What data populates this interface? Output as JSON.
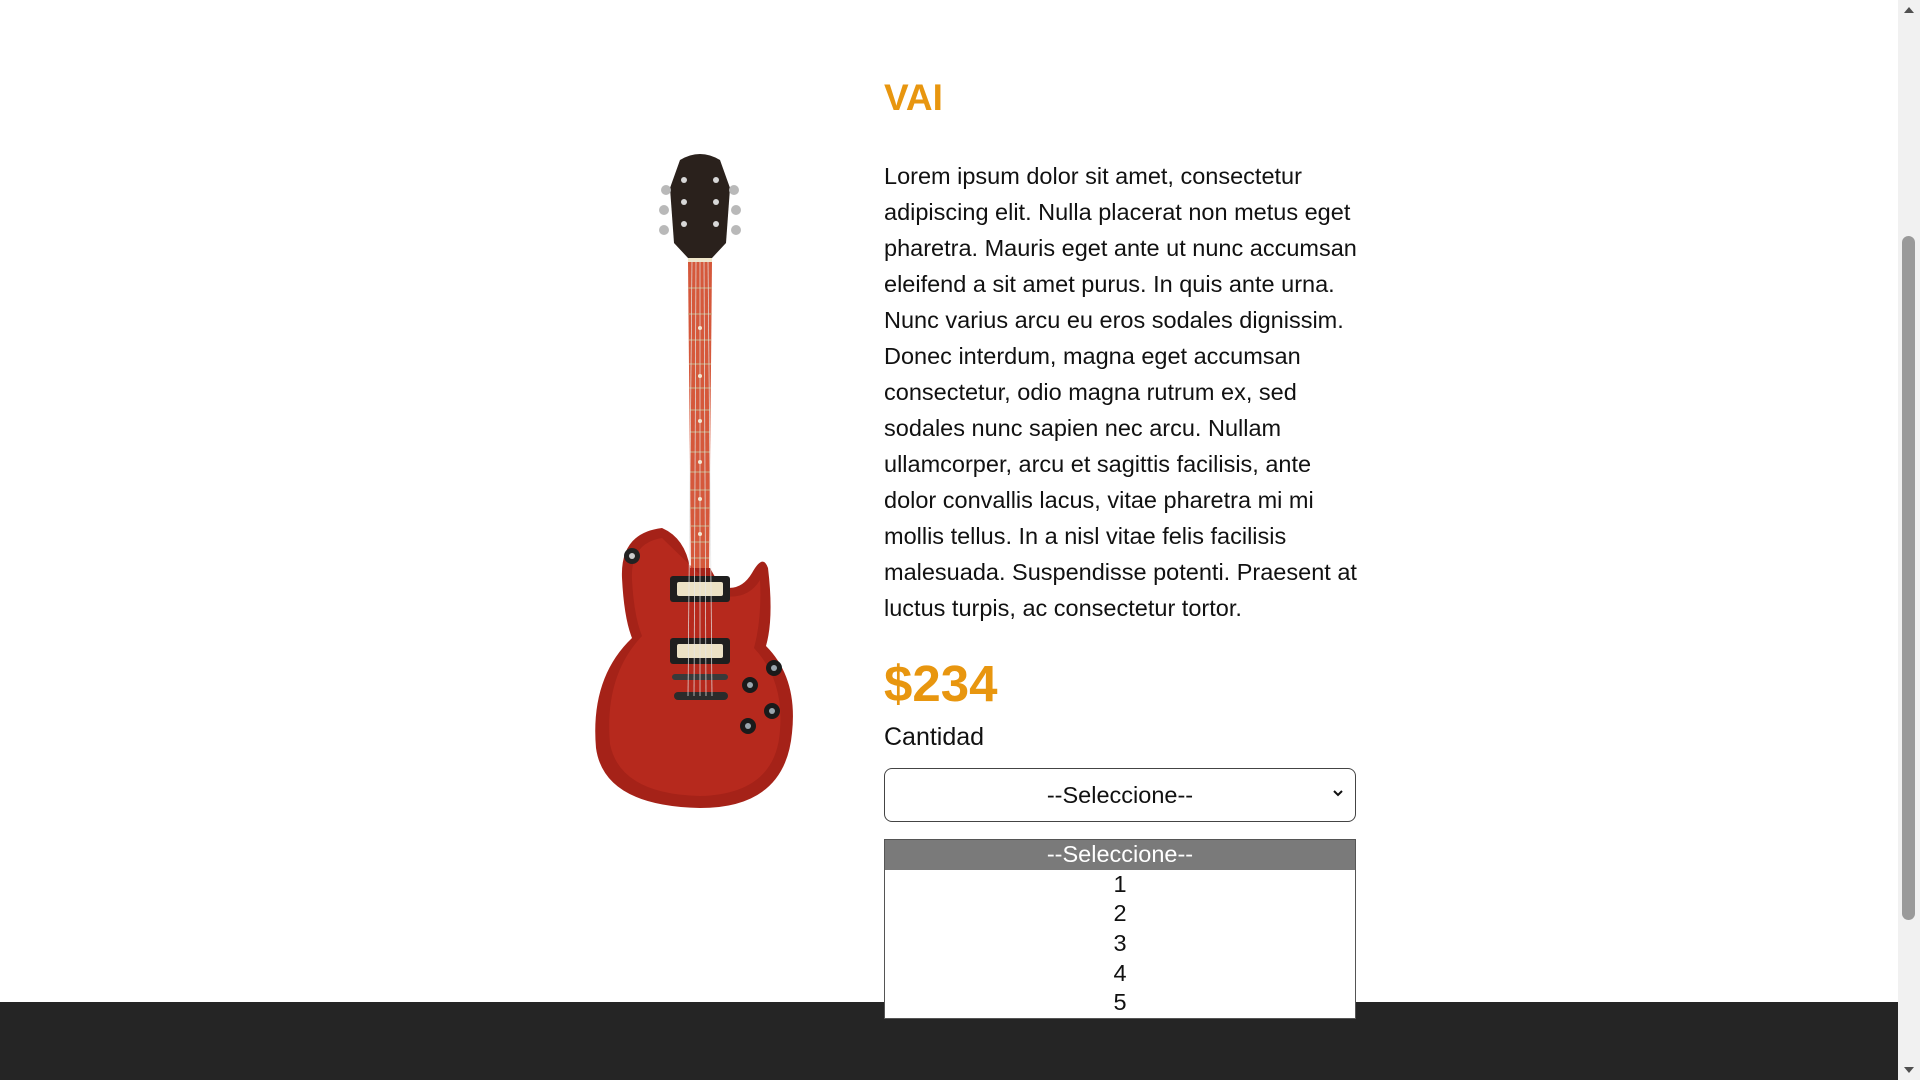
{
  "product": {
    "title": "VAI",
    "description": "Lorem ipsum dolor sit amet, consectetur adipiscing elit. Nulla placerat non metus eget pharetra. Mauris eget ante ut nunc accumsan eleifend a sit amet purus. In quis ante urna. Nunc varius arcu eu eros sodales dignissim. Donec interdum, magna eget accumsan consectetur, odio magna rutrum ex, sed sodales nunc sapien nec arcu. Nullam ullamcorper, arcu et sagittis facilisis, ante dolor convallis lacus, vitae pharetra mi mi mollis tellus. In a nisl vitae felis facilisis malesuada. Suspendisse potenti. Praesent at luctus turpis, ac consectetur tortor.",
    "price": "$234",
    "image_icon": "electric-guitar-icon"
  },
  "quantity": {
    "label": "Cantidad",
    "selected": "--Seleccione--",
    "options": [
      "--Seleccione--",
      "1",
      "2",
      "3",
      "4",
      "5"
    ]
  },
  "colors": {
    "accent": "#e8960f",
    "footer": "#252525",
    "option_highlight": "#7a7a7a"
  }
}
